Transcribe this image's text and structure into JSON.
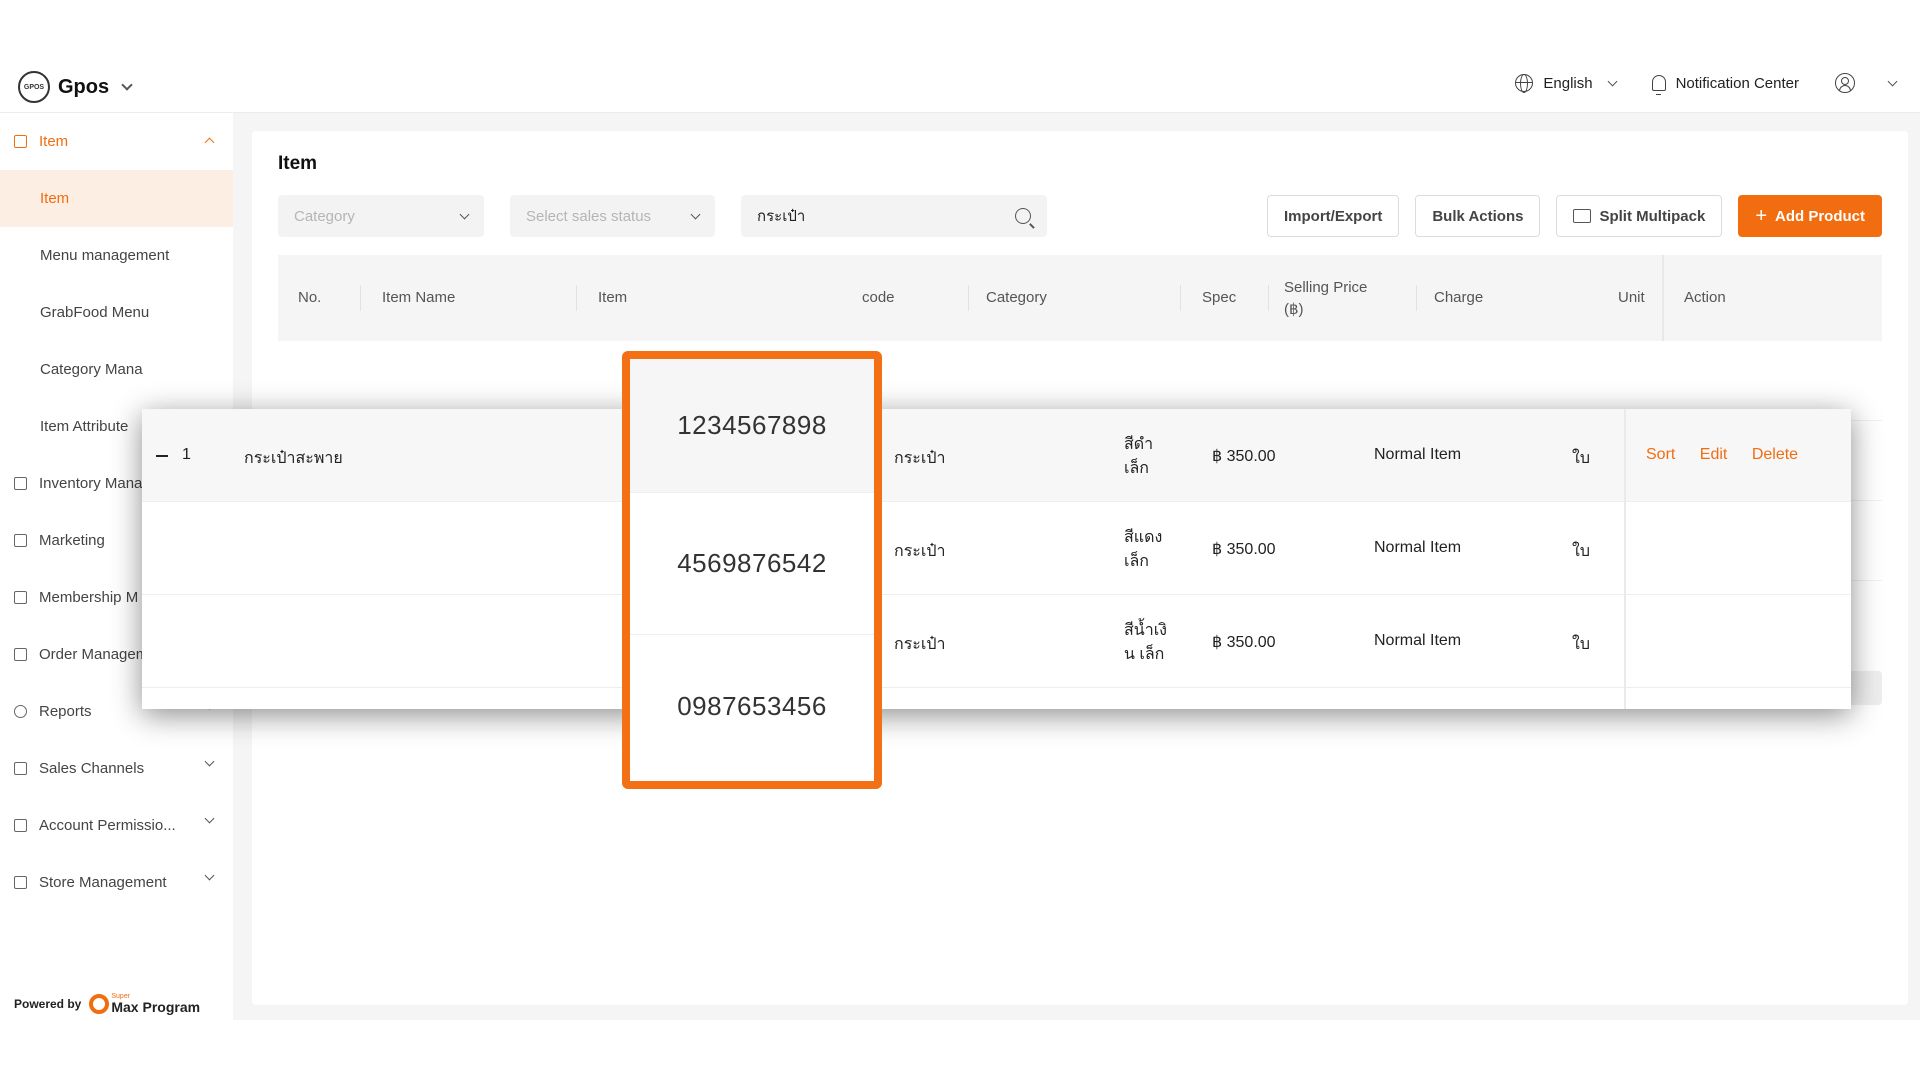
{
  "header": {
    "brand": "Gpos",
    "brand_logo_text": "GPOS",
    "language": "English",
    "notification": "Notification Center"
  },
  "sidebar": {
    "items": [
      {
        "label": "Item",
        "type": "group",
        "expanded": true
      },
      {
        "label": "Item",
        "type": "sub",
        "active": true
      },
      {
        "label": "Menu management",
        "type": "sub"
      },
      {
        "label": "GrabFood Menu",
        "type": "sub"
      },
      {
        "label": "Category Mana",
        "type": "sub"
      },
      {
        "label": "Item Attribute",
        "type": "sub"
      },
      {
        "label": "Inventory Mana",
        "type": "group"
      },
      {
        "label": "Marketing",
        "type": "group"
      },
      {
        "label": "Membership M",
        "type": "group"
      },
      {
        "label": "Order Management",
        "type": "group"
      },
      {
        "label": "Reports",
        "type": "group"
      },
      {
        "label": "Sales Channels",
        "type": "group"
      },
      {
        "label": "Account Permissio...",
        "type": "group"
      },
      {
        "label": "Store Management",
        "type": "group"
      }
    ],
    "powered_by": "Powered by",
    "powered_brand_top": "Super",
    "powered_brand": "Max Program"
  },
  "page": {
    "title": "Item",
    "filters": {
      "category_placeholder": "Category",
      "status_placeholder": "Select sales status",
      "search_value": "กระเป๋า"
    },
    "buttons": {
      "import_export": "Import/Export",
      "bulk_actions": "Bulk Actions",
      "split_multipack": "Split Multipack",
      "add_product": "Add Product"
    }
  },
  "table": {
    "headers": {
      "no": "No.",
      "item_name": "Item Name",
      "item_id": "Item",
      "barcode": "code",
      "category": "Category",
      "spec": "Spec",
      "selling_price_1": "Selling Price",
      "selling_price_2": "(฿)",
      "charge": "Charge",
      "unit": "Unit",
      "action": "Action"
    },
    "rows": [
      {
        "no": "1",
        "name": "กระเป๋าสะพาย",
        "barcode": "1234567898",
        "category": "กระเป๋า",
        "spec_1": "สีดำ",
        "spec_2": "เล็ก",
        "price": "฿ 350.00",
        "charge": "Normal Item",
        "unit": "ใบ"
      },
      {
        "no": "",
        "name": "",
        "barcode": "4569876542",
        "category": "กระเป๋า",
        "spec_1": "สีแดง",
        "spec_2": "เล็ก",
        "price": "฿ 350.00",
        "charge": "Normal Item",
        "unit": "ใบ"
      },
      {
        "no": "",
        "name": "",
        "barcode": "0987653456",
        "category": "กระเป๋า",
        "spec_1": "สีน้ำเงิ",
        "spec_2": "น เล็ก",
        "price": "฿ 350.00",
        "charge": "Normal Item",
        "unit": "ใบ"
      }
    ],
    "row_actions": {
      "sort": "Sort",
      "edit": "Edit",
      "delete": "Delete"
    }
  },
  "colors": {
    "accent": "#f26d0f",
    "highlight_border": "#f47014"
  }
}
